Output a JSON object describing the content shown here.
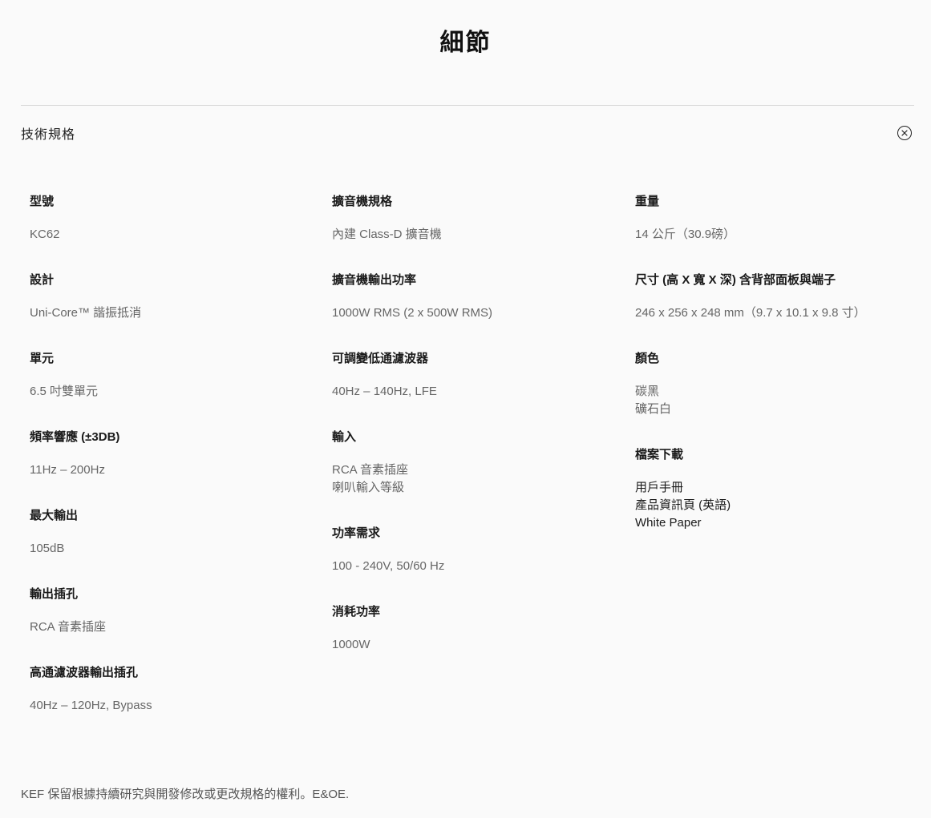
{
  "page": {
    "title": "細節"
  },
  "section": {
    "title": "技術規格"
  },
  "columns": [
    [
      {
        "label": "型號",
        "values": [
          "KC62"
        ]
      },
      {
        "label": "設計",
        "values": [
          "Uni-Core™ 諧振抵消"
        ]
      },
      {
        "label": "單元",
        "values": [
          "6.5 吋雙單元"
        ]
      },
      {
        "label": "頻率響應 (±3DB)",
        "values": [
          "11Hz – 200Hz"
        ]
      },
      {
        "label": "最大輸出",
        "values": [
          "105dB"
        ]
      },
      {
        "label": "輸出插孔",
        "values": [
          "RCA 音素插座"
        ]
      },
      {
        "label": "高通濾波器輸出插孔",
        "values": [
          "40Hz – 120Hz, Bypass"
        ]
      }
    ],
    [
      {
        "label": "擴音機規格",
        "values": [
          "內建 Class-D 擴音機"
        ]
      },
      {
        "label": "擴音機輸出功率",
        "values": [
          "1000W RMS (2 x 500W RMS)"
        ]
      },
      {
        "label": "可調變低通濾波器",
        "values": [
          "40Hz – 140Hz, LFE"
        ]
      },
      {
        "label": "輸入",
        "values": [
          "RCA 音素插座",
          "喇叭輸入等級"
        ]
      },
      {
        "label": "功率需求",
        "values": [
          "100 - 240V, 50/60 Hz"
        ]
      },
      {
        "label": "消耗功率",
        "values": [
          "1000W"
        ]
      }
    ],
    [
      {
        "label": "重量",
        "values": [
          "14 公斤（30.9磅）"
        ]
      },
      {
        "label": "尺寸 (高 X 寬 X 深) 含背部面板與端子",
        "values": [
          "246 x 256 x 248 mm（9.7 x 10.1 x 9.8 寸）"
        ]
      },
      {
        "label": "顏色",
        "values": [
          "碳黑",
          "礦石白"
        ]
      },
      {
        "label": "檔案下載",
        "links": [
          "用戶手冊",
          "產品資訊頁 (英語)",
          "White Paper"
        ]
      }
    ]
  ],
  "disclaimer": "KEF 保留根據持續研究與開發修改或更改規格的權利。E&OE."
}
